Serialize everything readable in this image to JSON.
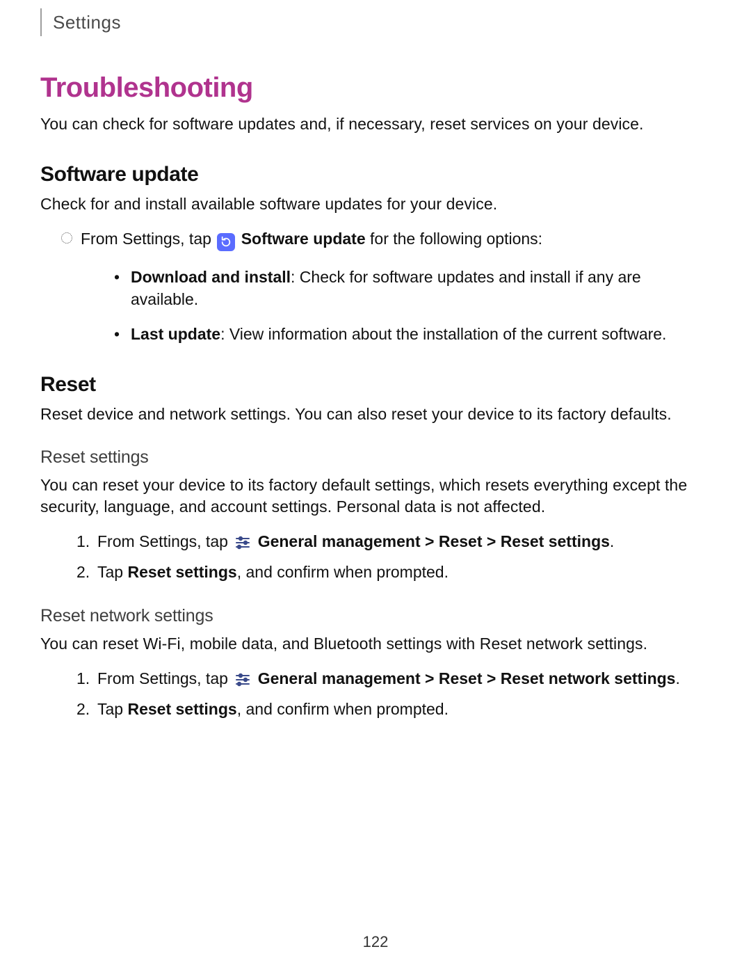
{
  "breadcrumb": "Settings",
  "title": "Troubleshooting",
  "intro": "You can check for software updates and, if necessary, reset services on your device.",
  "software_update": {
    "heading": "Software update",
    "body": "Check for and install available software updates for your device.",
    "lead_pre": "From Settings, tap ",
    "lead_bold": "Software update",
    "lead_post": " for the following options:",
    "items": [
      {
        "label": "Download and install",
        "desc": ": Check for software updates and install if any are available."
      },
      {
        "label": "Last update",
        "desc": ": View information about the installation of the current software."
      }
    ]
  },
  "reset": {
    "heading": "Reset",
    "body": "Reset device and network settings. You can also reset your device to its factory defaults.",
    "reset_settings": {
      "heading": "Reset settings",
      "body": "You can reset your device to its factory default settings, which resets everything except the security, language, and account settings. Personal data is not affected.",
      "steps": [
        {
          "n": "1.",
          "pre": "From Settings, tap ",
          "path": "General management > Reset > Reset settings",
          "post": "."
        },
        {
          "n": "2.",
          "pre": "Tap ",
          "bold": "Reset settings",
          "post": ", and confirm when prompted."
        }
      ]
    },
    "reset_network": {
      "heading": "Reset network settings",
      "body": "You can reset Wi-Fi, mobile data, and Bluetooth settings with Reset network settings.",
      "steps": [
        {
          "n": "1.",
          "pre": "From Settings, tap ",
          "path": "General management > Reset > Reset network settings",
          "post": "."
        },
        {
          "n": "2.",
          "pre": "Tap ",
          "bold": "Reset settings",
          "post": ", and confirm when prompted."
        }
      ]
    }
  },
  "page_number": "122"
}
